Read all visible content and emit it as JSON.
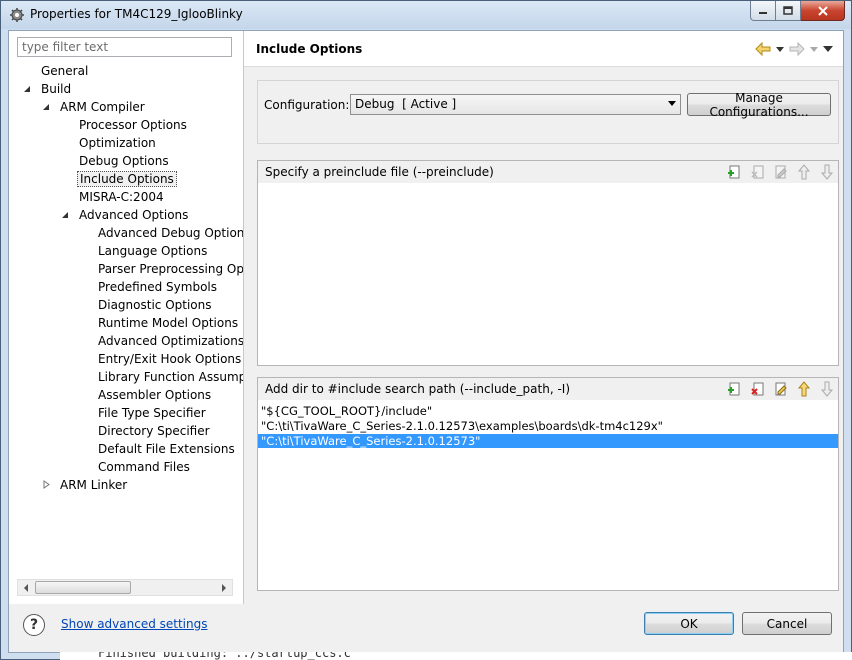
{
  "window": {
    "title": "Properties for TM4C129_IglooBlinky"
  },
  "filter": {
    "placeholder": "type filter text",
    "value": ""
  },
  "tree": {
    "items": [
      {
        "label": "General",
        "level": 0,
        "toggle": "none",
        "selected": false
      },
      {
        "label": "Build",
        "level": 0,
        "toggle": "expanded",
        "selected": false
      },
      {
        "label": "ARM Compiler",
        "level": 1,
        "toggle": "expanded",
        "selected": false
      },
      {
        "label": "Processor Options",
        "level": 2,
        "toggle": "none",
        "selected": false
      },
      {
        "label": "Optimization",
        "level": 2,
        "toggle": "none",
        "selected": false
      },
      {
        "label": "Debug Options",
        "level": 2,
        "toggle": "none",
        "selected": false
      },
      {
        "label": "Include Options",
        "level": 2,
        "toggle": "none",
        "selected": true
      },
      {
        "label": "MISRA-C:2004",
        "level": 2,
        "toggle": "none",
        "selected": false
      },
      {
        "label": "Advanced Options",
        "level": 2,
        "toggle": "expanded",
        "selected": false
      },
      {
        "label": "Advanced Debug Options",
        "level": 3,
        "toggle": "none",
        "selected": false
      },
      {
        "label": "Language Options",
        "level": 3,
        "toggle": "none",
        "selected": false
      },
      {
        "label": "Parser Preprocessing Opti",
        "level": 3,
        "toggle": "none",
        "selected": false
      },
      {
        "label": "Predefined Symbols",
        "level": 3,
        "toggle": "none",
        "selected": false
      },
      {
        "label": "Diagnostic Options",
        "level": 3,
        "toggle": "none",
        "selected": false
      },
      {
        "label": "Runtime Model Options",
        "level": 3,
        "toggle": "none",
        "selected": false
      },
      {
        "label": "Advanced Optimizations",
        "level": 3,
        "toggle": "none",
        "selected": false
      },
      {
        "label": "Entry/Exit Hook Options",
        "level": 3,
        "toggle": "none",
        "selected": false
      },
      {
        "label": "Library Function Assumpt",
        "level": 3,
        "toggle": "none",
        "selected": false
      },
      {
        "label": "Assembler Options",
        "level": 3,
        "toggle": "none",
        "selected": false
      },
      {
        "label": "File Type Specifier",
        "level": 3,
        "toggle": "none",
        "selected": false
      },
      {
        "label": "Directory Specifier",
        "level": 3,
        "toggle": "none",
        "selected": false
      },
      {
        "label": "Default File Extensions",
        "level": 3,
        "toggle": "none",
        "selected": false
      },
      {
        "label": "Command Files",
        "level": 3,
        "toggle": "none",
        "selected": false
      },
      {
        "label": "ARM Linker",
        "level": 1,
        "toggle": "collapsed",
        "selected": false
      }
    ]
  },
  "page": {
    "title": "Include Options",
    "nav_icons": [
      "back-arrow-icon",
      "forward-arrow-icon",
      "view-menu-icon"
    ]
  },
  "configuration": {
    "label": "Configuration:",
    "selected": "Debug  [ Active ]",
    "manage_label": "Manage Configurations..."
  },
  "preinclude": {
    "title": "Specify a preinclude file (--preinclude)",
    "items": []
  },
  "include_path": {
    "title": "Add dir to #include search path (--include_path, -I)",
    "items": [
      {
        "value": "\"${CG_TOOL_ROOT}/include\"",
        "selected": false
      },
      {
        "value": "\"C:\\ti\\TivaWare_C_Series-2.1.0.12573\\examples\\boards\\dk-tm4c129x\"",
        "selected": false
      },
      {
        "value": "\"C:\\ti\\TivaWare_C_Series-2.1.0.12573\"",
        "selected": true
      }
    ]
  },
  "list_tools": [
    "add-icon",
    "delete-icon",
    "edit-icon",
    "move-up-icon",
    "move-down-icon"
  ],
  "footer": {
    "advanced_link": "Show advanced settings",
    "ok_label": "OK",
    "cancel_label": "Cancel"
  },
  "background": {
    "console_text": "Finished building: ../startup_ccs.c"
  },
  "colors": {
    "selection": "#3399ff",
    "link": "#0046b5"
  }
}
